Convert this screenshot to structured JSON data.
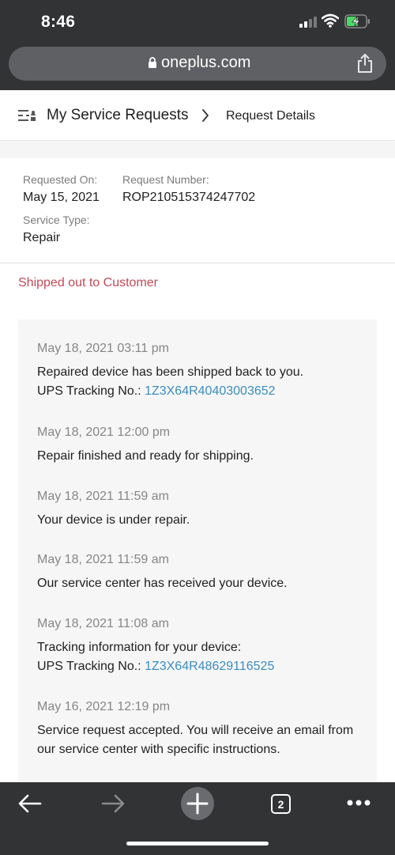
{
  "status_bar": {
    "time": "8:46"
  },
  "browser": {
    "url": "oneplus.com",
    "tab_count": "2"
  },
  "breadcrumb": {
    "parent": "My Service Requests",
    "current": "Request Details"
  },
  "details": {
    "requested_on_label": "Requested On:",
    "requested_on": "May 15, 2021",
    "request_number_label": "Request Number:",
    "request_number": "ROP210515374247702",
    "service_type_label": "Service Type:",
    "service_type": "Repair"
  },
  "status": "Shipped out to Customer",
  "timeline": [
    {
      "date": "May 18, 2021 03:11 pm",
      "message": "Repaired device has been shipped back to you.",
      "tracking_label": "UPS Tracking No.:",
      "tracking_number": "1Z3X64R40403003652"
    },
    {
      "date": "May 18, 2021 12:00 pm",
      "message": "Repair finished and ready for shipping."
    },
    {
      "date": "May 18, 2021 11:59 am",
      "message": "Your device is under repair."
    },
    {
      "date": "May 18, 2021 11:59 am",
      "message": "Our service center has received your device."
    },
    {
      "date": "May 18, 2021 11:08 am",
      "message": "Tracking information for your device:",
      "tracking_label": "UPS Tracking No.:",
      "tracking_number": "1Z3X64R48629116525"
    },
    {
      "date": "May 16, 2021 12:19 pm",
      "message": "Service request accepted. You will receive an email from our service center with specific instructions."
    }
  ],
  "colors": {
    "status": "#c24a57",
    "link": "#3c8dc0",
    "chrome": "#323335"
  }
}
